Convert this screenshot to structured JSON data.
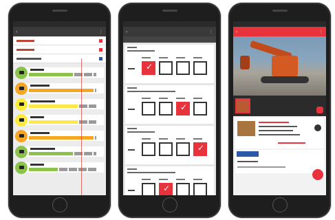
{
  "phones": [
    {
      "nav_title": "",
      "rows": [
        {
          "color": "#8bc34a",
          "fill": 0.62,
          "fill_color": "#8bc34a"
        },
        {
          "color": "#f5a623",
          "fill": 0.9,
          "fill_color": "#f5a623"
        },
        {
          "color": "#ffeb3b",
          "fill": 0.68,
          "fill_color": "#ffe94a"
        },
        {
          "color": "#ffeb3b",
          "fill": 0.68,
          "fill_color": "#ffe94a"
        },
        {
          "color": "#f5a623",
          "fill": 0.9,
          "fill_color": "#f5a623"
        },
        {
          "color": "#8bc34a",
          "fill": 0.62,
          "fill_color": "#8bc34a"
        },
        {
          "color": "#8bc34a",
          "fill": 0.4,
          "fill_color": "#8bc34a"
        }
      ]
    },
    {
      "nav_title": "",
      "checks": [
        [
          1,
          0,
          0,
          0
        ],
        [
          0,
          0,
          1,
          0
        ],
        [
          0,
          0,
          0,
          1
        ],
        [
          0,
          1,
          0,
          0
        ]
      ]
    },
    {
      "nav_title": ""
    }
  ],
  "colors": {
    "accent": "#e8323c",
    "brand_blue": "#2b59a8"
  }
}
